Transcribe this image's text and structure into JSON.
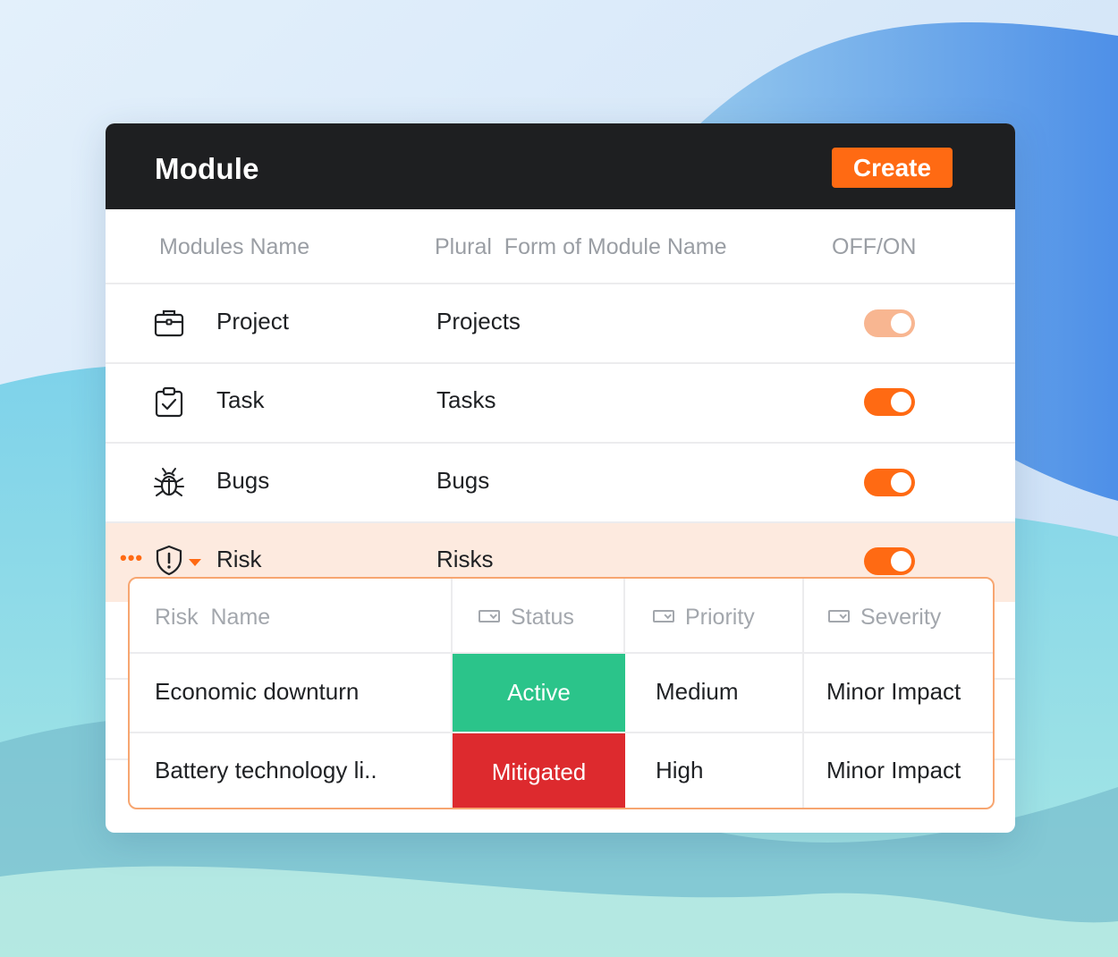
{
  "header": {
    "title": "Module",
    "create_label": "Create"
  },
  "columns": {
    "name": "Modules Name",
    "plural": "Plural  Form of Module Name",
    "toggle": "OFF/ON"
  },
  "modules": [
    {
      "name": "Project",
      "plural": "Projects",
      "icon": "briefcase-icon",
      "enabled": true
    },
    {
      "name": "Task",
      "plural": "Tasks",
      "icon": "clipboard-check-icon",
      "enabled": true
    },
    {
      "name": "Bugs",
      "plural": "Bugs",
      "icon": "bug-icon",
      "enabled": true
    },
    {
      "name": "Risk",
      "plural": "Risks",
      "icon": "shield-alert-icon",
      "enabled": true
    }
  ],
  "risk_table": {
    "headers": [
      "Risk  Name",
      "Status",
      "Priority",
      "Severity"
    ],
    "rows": [
      {
        "name": "Economic downturn",
        "status": "Active",
        "status_color": "#2bc48a",
        "priority": "Medium",
        "severity": "Minor Impact"
      },
      {
        "name": "Battery technology li..",
        "status": "Mitigated",
        "status_color": "#dd2a2e",
        "priority": "High",
        "severity": "Minor Impact"
      }
    ]
  },
  "colors": {
    "accent": "#ff6a13",
    "header_bg": "#1e1f21",
    "highlight_row": "#fdeadf"
  }
}
